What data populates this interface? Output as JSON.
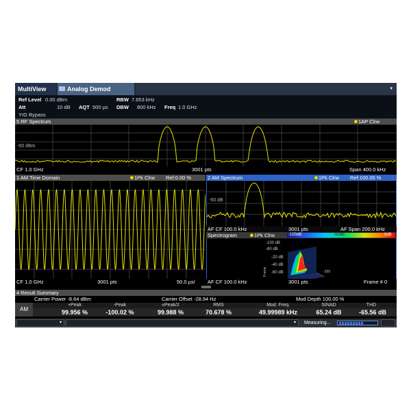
{
  "tabs": {
    "multiview": "MultiView",
    "analog_demod": "Analog Demod",
    "menu_arrow": "▾"
  },
  "params": {
    "ref_level_label": "Ref Level",
    "ref_level_value": "0.00 dBm",
    "att_label": "Att",
    "att_value": "10 dB",
    "aqt_label": "AQT",
    "aqt_value": "500 µs",
    "rbw_label": "RBW",
    "rbw_value": "7.653 kHz",
    "dbw_label": "DBW",
    "dbw_value": "800 kHz",
    "freq_label": "Freq",
    "freq_value": "1.0 GHz",
    "yig": "YIG Bypass"
  },
  "win_rf": {
    "title": "5 RF Spectrum",
    "trace": "1AP Clrw",
    "ylabel": "-50 dBm",
    "cf": "CF 1.0 GHz",
    "pts": "3001 pts",
    "span": "Span 400.0 kHz"
  },
  "win_am_time": {
    "title": "1 AM Time Domain",
    "trace": "1Pk Clrw",
    "ref": "Ref:0.00 %",
    "cf": "CF 1.0 GHz",
    "pts": "3001 pts",
    "div": "50.0 µs/"
  },
  "win_am_spec": {
    "title": "2 AM Spectrum",
    "trace": "1Pk Clrw",
    "ref": "Ref:100.00 %",
    "ylabel": "-50 dB",
    "cf": "AF CF 100.0 kHz",
    "pts": "3001 pts",
    "span": "AF Span 200.0 kHz"
  },
  "win_spectrogram": {
    "title": "Spectrogram",
    "trace": "1Pk Clrw",
    "scale_left": "-100dB",
    "scale_mid": "-50dB",
    "scale_right": "0dB",
    "z1": "-20 dB",
    "z2": "-40 dB",
    "z3": "-60 dB",
    "z4": "-80 dB",
    "z5": "-100 dB",
    "yaxis": "Frame",
    "xtick": "-299",
    "cf": "AF CF 100.0 kHz",
    "pts": "3001 pts",
    "frame": "Frame # 0"
  },
  "result_summary": {
    "title": "4 Result Summary",
    "carrier_power": "Carrier Power  -8.64 dBm",
    "carrier_offset": "Carrier Offset  -28.94 Hz",
    "mod_depth": "Mod Depth  100.00 %",
    "row_label": "AM",
    "headers": [
      "+Peak",
      "-Peak",
      "±Peak/2",
      "RMS",
      "Mod. Freq.",
      "SINAD",
      "THD"
    ],
    "values": [
      "99.956 %",
      "-100.02 %",
      "99.988 %",
      "70.678 %",
      "49.99989 kHz",
      "65.24 dB",
      "-65.56 dB"
    ]
  },
  "status": {
    "measuring": "Measuring...",
    "progress_fraction": 0.65
  }
}
